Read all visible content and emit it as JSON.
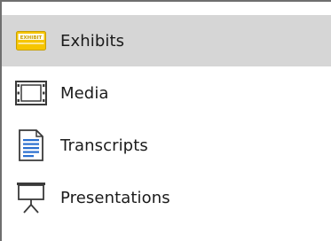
{
  "nav": {
    "items": [
      {
        "label": "Exhibits",
        "icon": "exhibit-tag-icon",
        "selected": true
      },
      {
        "label": "Media",
        "icon": "film-icon",
        "selected": false
      },
      {
        "label": "Transcripts",
        "icon": "document-icon",
        "selected": false
      },
      {
        "label": "Presentations",
        "icon": "presentation-board-icon",
        "selected": false
      }
    ]
  },
  "colors": {
    "selected_bg": "#d6d6d6",
    "exhibit_icon": "#f2c200",
    "document_icon": "#2a6fcf"
  }
}
